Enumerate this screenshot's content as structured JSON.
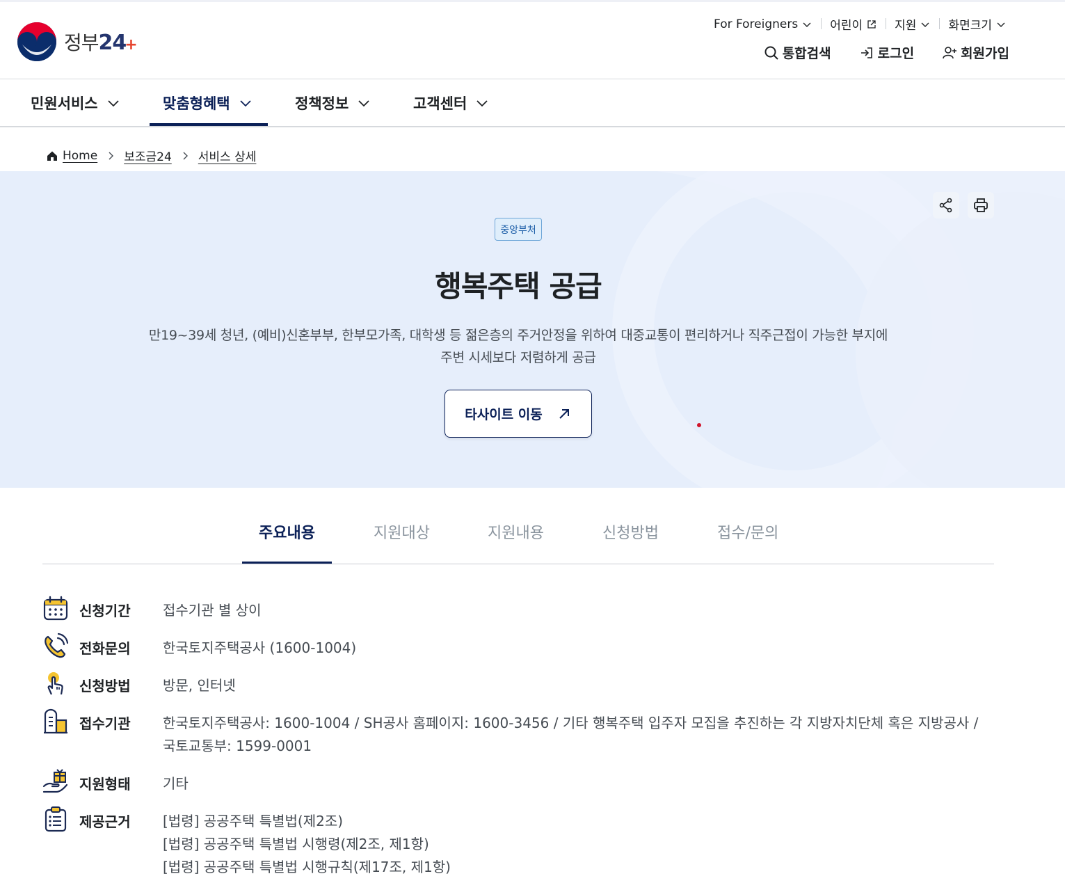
{
  "header": {
    "logo_kor": "정부",
    "logo_num": "24",
    "utility": [
      {
        "label": "For Foreigners",
        "icon": "chevron-down-icon"
      },
      {
        "label": "어린이",
        "icon": "external-link-icon"
      },
      {
        "label": "지원",
        "icon": "chevron-down-icon"
      },
      {
        "label": "화면크기",
        "icon": "chevron-down-icon"
      }
    ],
    "actions": {
      "search": "통합검색",
      "login": "로그인",
      "signup": "회원가입"
    }
  },
  "nav": {
    "items": [
      "민원서비스",
      "맞춤형혜택",
      "정책정보",
      "고객센터"
    ],
    "active": "맞춤형혜택"
  },
  "breadcrumb": [
    "Home",
    "보조금24",
    "서비스 상세"
  ],
  "hero": {
    "badge": "중앙부처",
    "title": "행복주택 공급",
    "description_line1": "만19~39세 청년, (예비)신혼부부, 한부모가족, 대학생 등 젊은층의 주거안정을 위하여 대중교통이 편리하거나 직주근접이 가능한 부지에",
    "description_line2": "주변 시세보다 저렴하게 공급",
    "button": "타사이트 이동"
  },
  "tabs": [
    "주요내용",
    "지원대상",
    "지원내용",
    "신청방법",
    "접수/문의"
  ],
  "info": [
    {
      "label": "신청기간",
      "icon": "calendar-icon",
      "lines": [
        "접수기관 별 상이"
      ]
    },
    {
      "label": "전화문의",
      "icon": "phone-icon",
      "lines": [
        "한국토지주택공사 (1600-1004)"
      ]
    },
    {
      "label": "신청방법",
      "icon": "hand-pointer-icon",
      "lines": [
        "방문, 인터넷"
      ]
    },
    {
      "label": "접수기관",
      "icon": "building-icon",
      "lines": [
        "한국토지주택공사: 1600-1004 / SH공사 홈페이지: 1600-3456 / 기타 행복주택 입주자 모집을 추진하는 각 지방자치단체 혹은 지방공사 /",
        "국토교통부: 1599-0001"
      ]
    },
    {
      "label": "지원형태",
      "icon": "gift-hand-icon",
      "lines": [
        "기타"
      ]
    },
    {
      "label": "제공근거",
      "icon": "clipboard-list-icon",
      "lines": [
        "[법령] 공공주택 특별법(제2조)",
        "[법령] 공공주택 특별법 시행령(제2조, 제1항)",
        "[법령] 공공주택 특별법 시행규칙(제17조, 제1항)"
      ]
    }
  ]
}
